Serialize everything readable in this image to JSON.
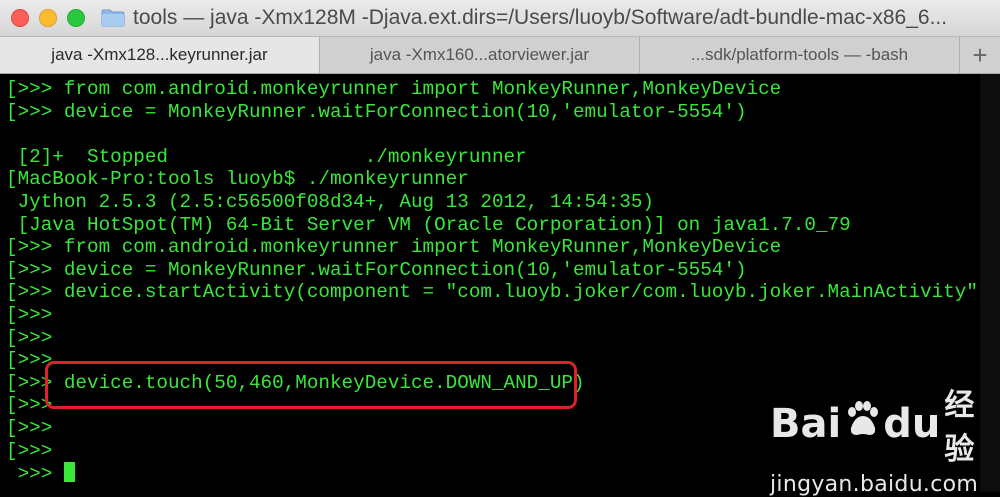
{
  "window": {
    "title": "tools — java -Xmx128M -Djava.ext.dirs=/Users/luoyb/Software/adt-bundle-mac-x86_6..."
  },
  "tabs": [
    {
      "label": "java -Xmx128...keyrunner.jar",
      "active": true
    },
    {
      "label": "java -Xmx160...atorviewer.jar",
      "active": false
    },
    {
      "label": "...sdk/platform-tools — -bash",
      "active": false
    }
  ],
  "new_tab_label": "+",
  "terminal": {
    "lines": [
      "[>>> from com.android.monkeyrunner import MonkeyRunner,MonkeyDevice",
      "[>>> device = MonkeyRunner.waitForConnection(10,'emulator-5554')",
      "",
      " [2]+  Stopped                 ./monkeyrunner",
      "[MacBook-Pro:tools luoyb$ ./monkeyrunner",
      " Jython 2.5.3 (2.5:c56500f08d34+, Aug 13 2012, 14:54:35)",
      " [Java HotSpot(TM) 64-Bit Server VM (Oracle Corporation)] on java1.7.0_79",
      "[>>> from com.android.monkeyrunner import MonkeyRunner,MonkeyDevice",
      "[>>> device = MonkeyRunner.waitForConnection(10,'emulator-5554')",
      "[>>> device.startActivity(component = \"com.luoyb.joker/com.luoyb.joker.MainActivity\")",
      "[>>>",
      "[>>>",
      "[>>>",
      "[>>> device.touch(50,460,MonkeyDevice.DOWN_AND_UP)",
      "[>>>",
      "[>>>",
      "[>>>"
    ],
    "prompt": " >>> "
  },
  "watermark": {
    "brand_left": "Bai",
    "brand_right": "du",
    "brand_cn": "经验",
    "url": "jingyan.baidu.com"
  },
  "colors": {
    "terminal_bg": "#000000",
    "terminal_fg": "#39e639",
    "highlight": "#e0202a"
  }
}
